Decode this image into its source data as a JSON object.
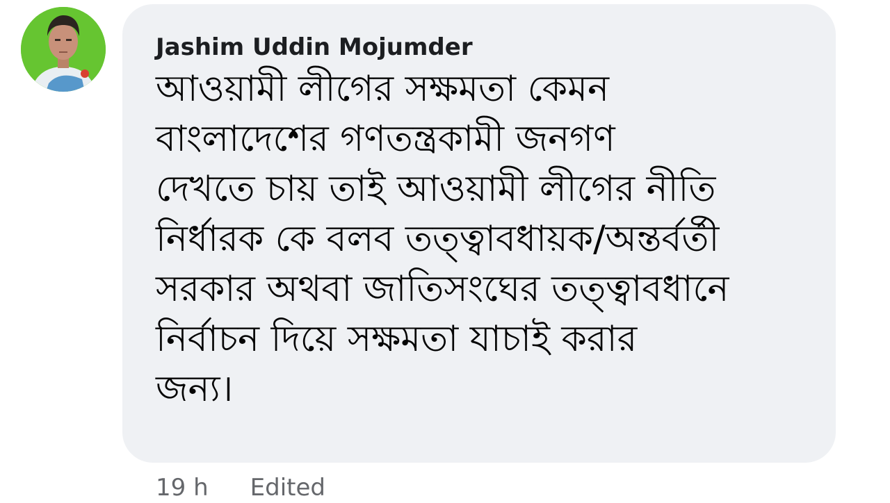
{
  "comment": {
    "author": "Jashim Uddin Mojumder",
    "text": "আওয়ামী লীগের সক্ষমতা কেমন\nবাংলাদেশের গণতন্ত্রকামী জনগণ\nদেখতে চায় তাই আওয়ামী লীগের নীতি\nনির্ধারক কে বলব তত্ত্বাবধায়ক/অন্তর্বর্তী\nসরকার অথবা জাতিসংঘের তত্ত্বাবধানে\nনির্বাচন দিয়ে সক্ষমতা যাচাই করার\nজন্য।",
    "timestamp": "19 h",
    "edited_label": "Edited"
  },
  "colors": {
    "bubble_bg": "#eff1f4",
    "avatar_bg": "#66c531",
    "author_text": "#1c1e21",
    "meta_text": "#65676b"
  },
  "icons": {
    "avatar": "profile-photo-avatar"
  }
}
